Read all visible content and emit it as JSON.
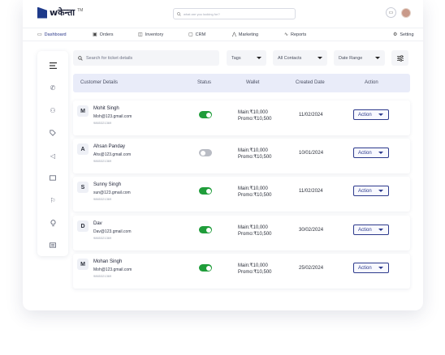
{
  "app": {
    "logo_text": "wकेन्ता",
    "logo_tm": "TM",
    "search_placeholder": "what are you looking for?"
  },
  "nav": [
    {
      "label": "Dashboard",
      "icon": "dashboard-icon",
      "glyph": "▭"
    },
    {
      "label": "Orders",
      "icon": "orders-icon",
      "glyph": "▣"
    },
    {
      "label": "Inventory",
      "icon": "inventory-icon",
      "glyph": "◫"
    },
    {
      "label": "CRM",
      "icon": "crm-icon",
      "glyph": "▢"
    },
    {
      "label": "Marketing",
      "icon": "marketing-icon",
      "glyph": "⋀"
    },
    {
      "label": "Reports",
      "icon": "reports-icon",
      "glyph": "∿"
    },
    {
      "label": "Setting",
      "icon": "settings-icon",
      "glyph": "⚙"
    }
  ],
  "filters": {
    "search_placeholder": "Search for ticket details",
    "tags": "Tags",
    "contacts": "All Contacts",
    "date_range": "Date Range"
  },
  "table": {
    "headers": [
      "Customer Details",
      "Status",
      "Wallet",
      "Created Date",
      "Action"
    ],
    "rows": [
      {
        "initial": "M",
        "name": "Mohit Singh",
        "email": "Moh@123.gmail.com",
        "phone": "9865321369",
        "status": "on",
        "main": "Main:₹10,000",
        "promo": "Promo:₹10,500",
        "date": "11/02/2024",
        "action": "Action"
      },
      {
        "initial": "A",
        "name": "Ahsan Panday",
        "email": "Ahs@123.gmail.com",
        "phone": "9865321369",
        "status": "off",
        "main": "Main:₹10,000",
        "promo": "Promo:₹10,500",
        "date": "10/01/2024",
        "action": "Action"
      },
      {
        "initial": "S",
        "name": "Sunny Singh",
        "email": "sun@123.gmail.com",
        "phone": "9865321369",
        "status": "on",
        "main": "Main:₹10,000",
        "promo": "Promo:₹10,500",
        "date": "11/02/2024",
        "action": "Action"
      },
      {
        "initial": "D",
        "name": "Dav",
        "email": "Dav@123.gmail.com",
        "phone": "9865321369",
        "status": "on",
        "main": "Main:₹10,000",
        "promo": "Promo:₹10,500",
        "date": "30/02/2024",
        "action": "Action"
      },
      {
        "initial": "M",
        "name": "Mohan Singh",
        "email": "Moh@123.gmail.com",
        "phone": "9865321369",
        "status": "on",
        "main": "Main:₹10,000",
        "promo": "Promo:₹10,500",
        "date": "25/02/2024",
        "action": "Action"
      }
    ]
  },
  "sidebar_icons": [
    "menu-icon",
    "phone-icon",
    "add-user-icon",
    "tag-icon",
    "megaphone-icon",
    "mail-icon",
    "flag-icon",
    "lightbulb-icon",
    "chat-icon"
  ],
  "colors": {
    "accent": "#2d3a8c",
    "toggle_on": "#1f9d3a",
    "toggle_off": "#b9bcc4",
    "header_bg": "#e9ecf9"
  }
}
